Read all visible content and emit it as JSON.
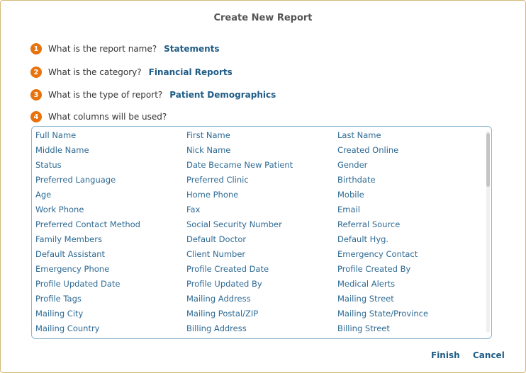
{
  "dialog": {
    "title": "Create New Report",
    "questions": [
      {
        "number": "1",
        "text": "What is the report name?",
        "answer": "Statements"
      },
      {
        "number": "2",
        "text": "What is the category?",
        "answer": "Financial Reports"
      },
      {
        "number": "3",
        "text": "What is the type of report?",
        "answer": "Patient Demographics"
      },
      {
        "number": "4",
        "text": "What columns will be used?",
        "answer": ""
      }
    ],
    "columns": [
      "Full Name",
      "First Name",
      "Last Name",
      "Middle Name",
      "Nick Name",
      "Created Online",
      "Status",
      "Date Became New Patient",
      "Gender",
      "Preferred Language",
      "Preferred Clinic",
      "Birthdate",
      "Age",
      "Home Phone",
      "Mobile",
      "Work Phone",
      "Fax",
      "Email",
      "Preferred Contact Method",
      "Social Security Number",
      "Referral Source",
      "Family Members",
      "Default Doctor",
      "Default Hyg.",
      "Default Assistant",
      "Client Number",
      "Emergency Contact",
      "Emergency Phone",
      "Profile Created Date",
      "Profile Created By",
      "Profile Updated Date",
      "Profile Updated By",
      "Medical Alerts",
      "Profile Tags",
      "Mailing Address",
      "Mailing Street",
      "Mailing City",
      "Mailing Postal/ZIP",
      "Mailing State/Province",
      "Mailing Country",
      "Billing Address",
      "Billing Street"
    ],
    "buttons": {
      "finish": "Finish",
      "cancel": "Cancel"
    },
    "colors": {
      "step_badge": "#e8720c",
      "answer_text": "#1f5c86",
      "column_text": "#2e6a93",
      "box_border": "#8ab4d0"
    }
  }
}
